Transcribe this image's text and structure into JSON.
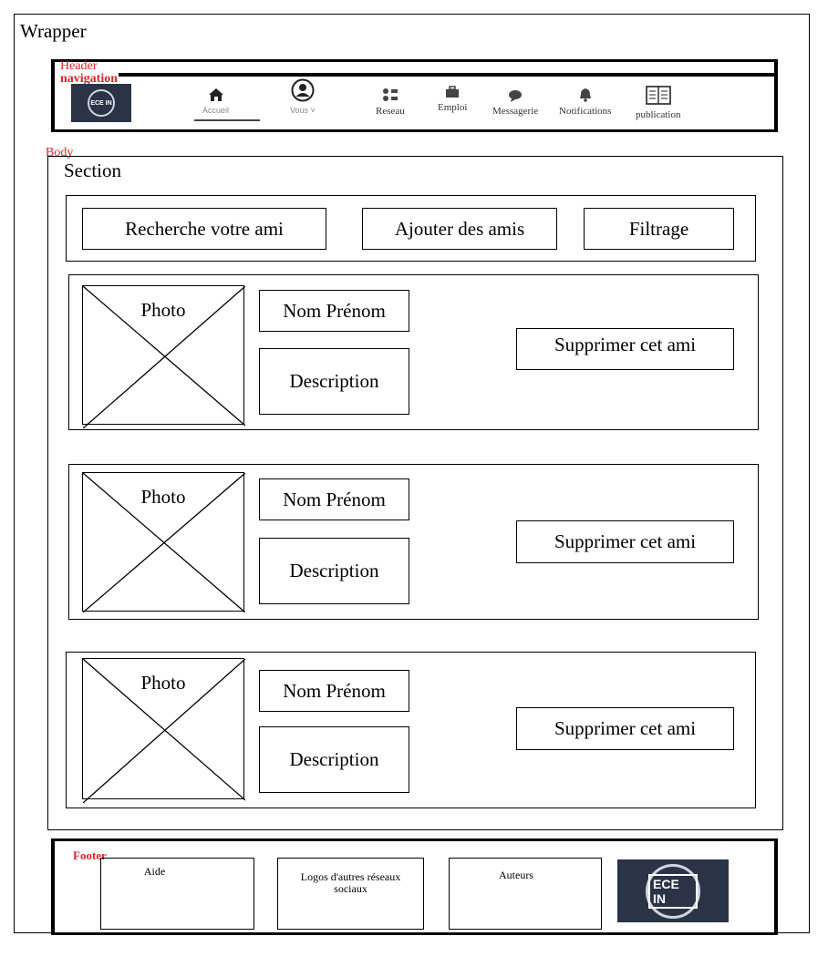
{
  "wrapper": {
    "label": "Wrapper"
  },
  "header": {
    "label": "Header",
    "nav_label": "navigation",
    "logo_text": "ECE IN",
    "nav_items": [
      {
        "label": "Accueil",
        "icon": "home-icon"
      },
      {
        "label": "Vous ˅",
        "icon": "user-icon"
      },
      {
        "label": "Reseau",
        "icon": "network-icon"
      },
      {
        "label": "Emploi",
        "icon": "briefcase-icon"
      },
      {
        "label": "Messagerie",
        "icon": "chat-icon"
      },
      {
        "label": "Notifications",
        "icon": "bell-icon"
      },
      {
        "label": "publication",
        "icon": "book-icon"
      }
    ]
  },
  "body": {
    "label": "Body",
    "section_label": "Section",
    "toolbar": {
      "search": "Recherche votre ami",
      "add_friends": "Ajouter des amis",
      "filter": "Filtrage"
    },
    "friends": [
      {
        "photo": "Photo",
        "name": "Nom Prénom",
        "description": "Description",
        "delete": "Supprimer cet ami"
      },
      {
        "photo": "Photo",
        "name": "Nom Prénom",
        "description": "Description",
        "delete": "Supprimer cet ami"
      },
      {
        "photo": "Photo",
        "name": "Nom Prénom",
        "description": "Description",
        "delete": "Supprimer cet ami"
      }
    ]
  },
  "footer": {
    "label": "Footer",
    "help": "Aide",
    "social_logos": "Logos d'autres réseaux sociaux",
    "authors": "Auteurs",
    "logo_text": "ECE IN"
  }
}
